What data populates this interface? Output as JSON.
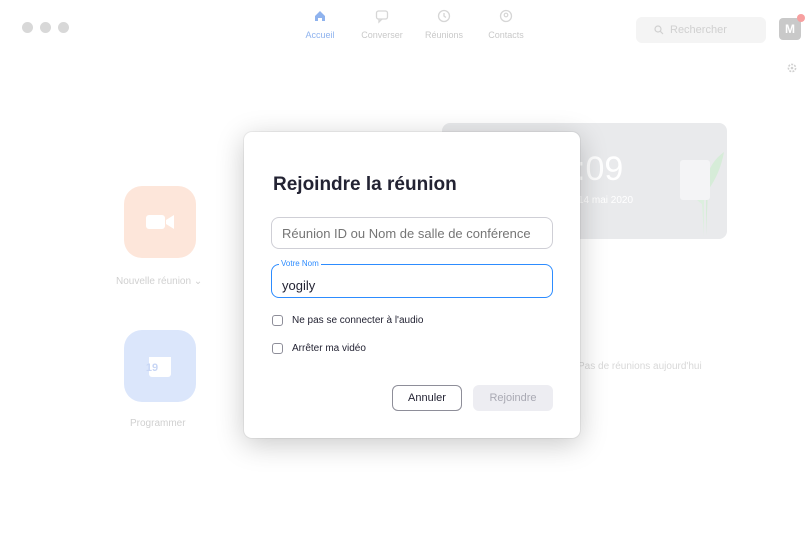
{
  "topbar": {
    "tabs": [
      {
        "label": "Accueil",
        "active": true,
        "icon": "home-icon"
      },
      {
        "label": "Converser",
        "active": false,
        "icon": "chat-icon"
      },
      {
        "label": "Réunions",
        "active": false,
        "icon": "clock-icon"
      },
      {
        "label": "Contacts",
        "active": false,
        "icon": "contact-icon"
      }
    ],
    "search_placeholder": "Rechercher",
    "avatar_initial": "M"
  },
  "home": {
    "new_meeting_label": "Nouvelle réunion",
    "schedule_label": "Programmer",
    "calendar_day": "19",
    "clock_time": ":09",
    "clock_date": "14 mai 2020",
    "no_meetings": "Pas de réunions aujourd'hui"
  },
  "dialog": {
    "title": "Rejoindre la réunion",
    "meeting_id_placeholder": "Réunion ID ou Nom de salle de conférence",
    "name_label": "Votre Nom",
    "name_value": "yogily",
    "checkbox_audio": "Ne pas se connecter à l'audio",
    "checkbox_audio_checked": false,
    "checkbox_video": "Arrêter ma vidéo",
    "checkbox_video_checked": false,
    "cancel_label": "Annuler",
    "join_label": "Rejoindre"
  },
  "colors": {
    "accent": "#2d8cff",
    "new_meeting": "#fde6da",
    "schedule": "#dbe6fb"
  }
}
